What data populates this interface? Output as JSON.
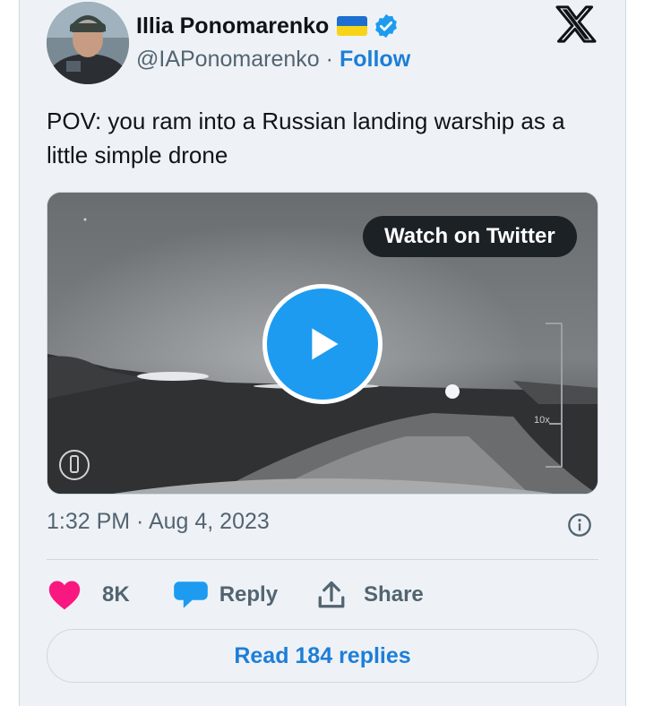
{
  "author": {
    "name": "Illia Ponomarenko",
    "handle": "@IAPonomarenko",
    "separator": "·",
    "follow_label": "Follow",
    "flag_colors": [
      "#1e6fd1",
      "#f7d417"
    ],
    "verified_color": "#1d9bf0"
  },
  "tweet": {
    "text": "POV: you ram into a Russian landing warship as a little simple drone",
    "timestamp": "1:32 PM · Aug 4, 2023"
  },
  "media": {
    "watch_label": "Watch on Twitter",
    "play_color": "#1d9bf0",
    "hud_zoom": "10x"
  },
  "actions": {
    "like_count": "8K",
    "reply_label": "Reply",
    "share_label": "Share",
    "like_color": "#f91880",
    "reply_icon_color": "#1d9bf0"
  },
  "footer": {
    "read_replies_label": "Read 184 replies"
  },
  "icons": {
    "logo": "x-logo-icon",
    "verified": "verified-badge-icon",
    "info": "info-icon",
    "like": "heart-icon",
    "reply": "reply-bubble-icon",
    "share": "share-icon",
    "play": "play-icon"
  }
}
